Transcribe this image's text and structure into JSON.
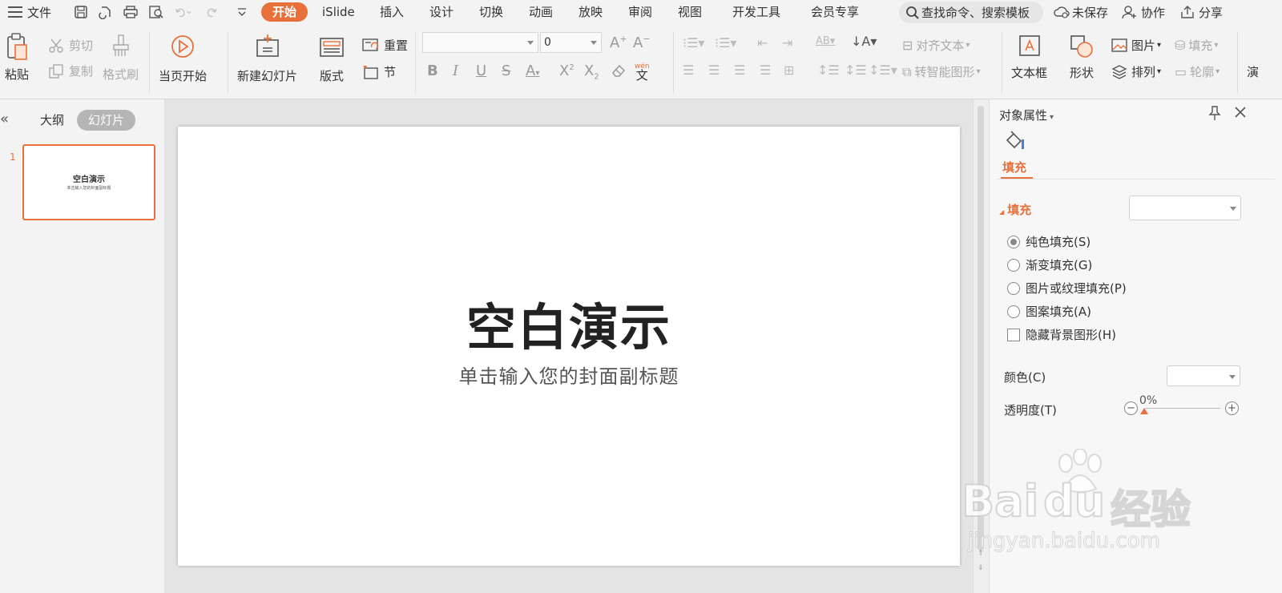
{
  "menubar": {
    "file": "文件",
    "tabs": [
      "开始",
      "iSlide",
      "插入",
      "设计",
      "切换",
      "动画",
      "放映",
      "审阅",
      "视图",
      "开发工具",
      "会员专享"
    ],
    "active_tab": "开始",
    "search": "查找命令、搜索模板",
    "unsaved": "未保存",
    "collab": "协作",
    "share": "分享"
  },
  "ribbon": {
    "paste": "粘贴",
    "cut": "剪切",
    "copy": "复制",
    "format_painter": "格式刷",
    "from_current": "当页开始",
    "new_slide": "新建幻灯片",
    "layout": "版式",
    "reset": "重置",
    "section": "节",
    "font_size": "0",
    "align_text": "对齐文本",
    "smartart": "转智能图形",
    "textbox": "文本框",
    "shape": "形状",
    "picture": "图片",
    "arrange": "排列",
    "fill": "填充",
    "outline": "轮廓",
    "overflow": "演",
    "wen_top": "wén",
    "wen_bottom": "文"
  },
  "left_panel": {
    "tab_outline": "大纲",
    "tab_slides": "幻灯片",
    "slide_number": "1",
    "thumb_title": "空白演示",
    "thumb_subtitle": "单击输入您的封面副标题"
  },
  "slide": {
    "title": "空白演示",
    "subtitle": "单击输入您的封面副标题"
  },
  "right_pane": {
    "title": "对象属性",
    "tab_fill": "填充",
    "section_fill": "填充",
    "options": [
      "纯色填充(S)",
      "渐变填充(G)",
      "图片或纹理填充(P)",
      "图案填充(A)"
    ],
    "selected_option": 0,
    "hide_bg": "隐藏背景图形(H)",
    "color_label": "颜色(C)",
    "transparency_label": "透明度(T)",
    "transparency_value": "0%"
  },
  "watermark": {
    "brand": "Bai",
    "brand_tail": "du",
    "brand_cn": "经验",
    "url": "jingyan.baidu.com"
  },
  "colors": {
    "accent": "#e8703b",
    "ribbon_bg": "#f3f3f3",
    "canvas_bg": "#e4e4e4"
  }
}
